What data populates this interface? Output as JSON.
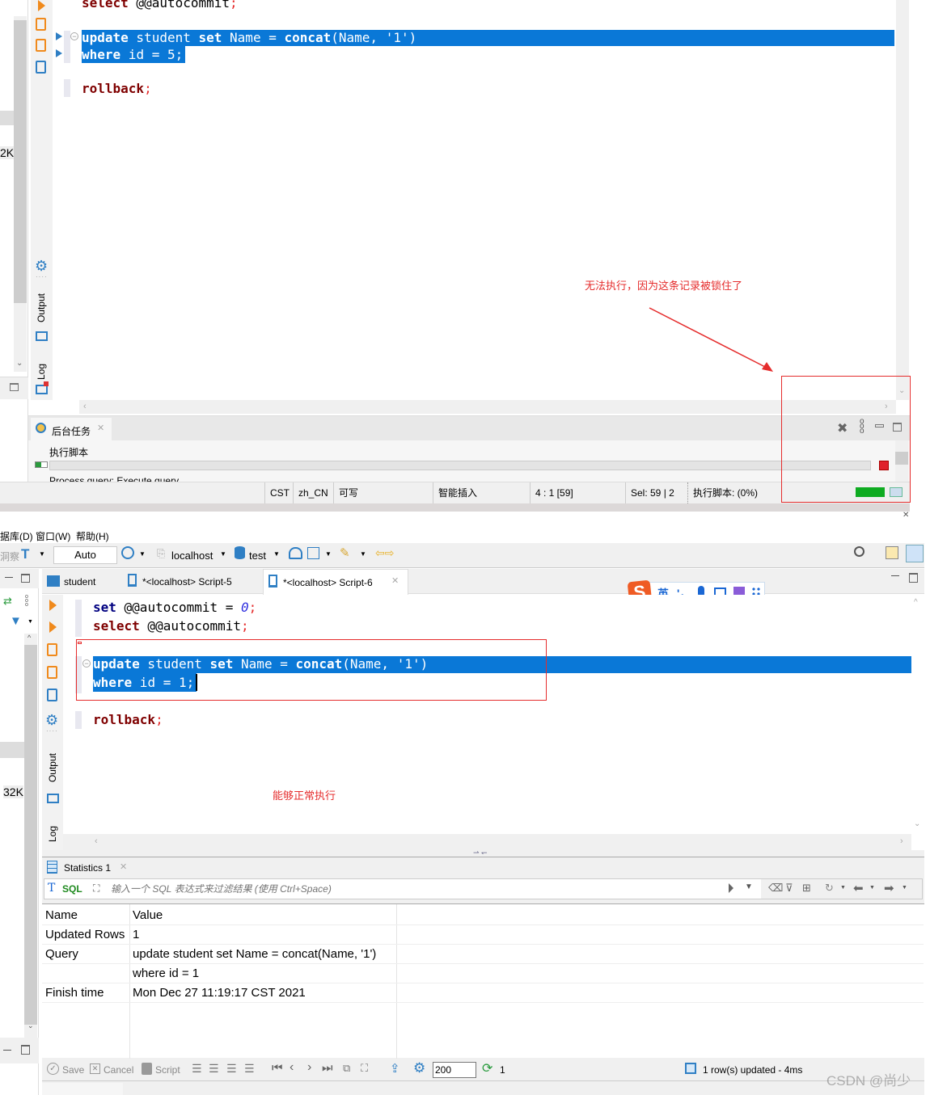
{
  "top_window": {
    "left_panel": {
      "size_label": "2K"
    },
    "code_lines": {
      "line1": {
        "kw": "select",
        "rest": " @@autocommit",
        "semi": ";"
      },
      "line_update": {
        "kw1": "update",
        "t1": " student ",
        "kw2": "set",
        "t2": " Name = ",
        "kw3": "concat",
        "t3": "(Name, '1')"
      },
      "line_where": {
        "kw": "where",
        "rest": " id = 5;"
      },
      "line_rollback": {
        "kw": "rollback",
        "semi": ";"
      }
    },
    "side_tabs": {
      "output": "Output",
      "log": "Log"
    },
    "annotation": "无法执行，因为这条记录被锁住了",
    "bg_tasks_panel": {
      "tab_label": "后台任务",
      "task_name": "执行脚本",
      "progress_percent": 0,
      "task_detail": "Process query:  Execute query"
    },
    "status_bar": {
      "timezone": "CST",
      "locale": "zh_CN",
      "write_mode": "可写",
      "insert_mode": "智能插入",
      "cursor_pos": "4 : 1 [59]",
      "selection": "Sel: 59 | 2",
      "task_status": "执行脚本:   (0%)"
    }
  },
  "bottom_window": {
    "menu": [
      "据库(D)",
      "窗口(W)",
      "帮助(H)"
    ],
    "toolbar": {
      "left_label": "洞察",
      "transaction_mode": "Auto",
      "connection": "localhost",
      "database": "test"
    },
    "left_panel": {
      "size_label": "32K"
    },
    "editor_tabs": [
      {
        "label": "student",
        "active": false
      },
      {
        "label": "*<localhost> Script-5",
        "active": false
      },
      {
        "label": "*<localhost> Script-6",
        "active": true
      }
    ],
    "ime_toolbar": {
      "lang": "英",
      "punct": "'，"
    },
    "code_lines": {
      "line_set": {
        "kw": "set",
        "rest": " @@autocommit = ",
        "num": "0",
        "semi": ";"
      },
      "line_select": {
        "kw": "select",
        "rest": " @@autocommit",
        "semi": ";"
      },
      "line_update": {
        "kw1": "update",
        "t1": " student ",
        "kw2": "set",
        "t2": " Name = ",
        "kw3": "concat",
        "t3": "(Name, '1')"
      },
      "line_where": {
        "kw": "where",
        "rest": " id = 1;"
      },
      "line_rollback": {
        "kw": "rollback",
        "semi": ";"
      }
    },
    "side_tabs": {
      "output": "Output",
      "log": "Log"
    },
    "annotation": "能够正常执行",
    "results": {
      "tab_label": "Statistics 1",
      "filter_mode": "SQL",
      "filter_placeholder": "输入一个 SQL 表达式来过滤结果 (使用 Ctrl+Space)",
      "columns": [
        "Name",
        "Value"
      ],
      "rows": [
        {
          "name": "Updated Rows",
          "value": "1"
        },
        {
          "name": "Query",
          "value": "update student set Name = concat(Name, '1')"
        },
        {
          "name": "",
          "value": "where id = 1"
        },
        {
          "name": "Finish time",
          "value": "Mon Dec 27 11:19:17 CST 2021"
        }
      ],
      "bottom_toolbar": {
        "save": "Save",
        "cancel": "Cancel",
        "script": "Script",
        "fetch_size": "200",
        "refresh_count": "1",
        "status": "1 row(s) updated - 4ms"
      }
    }
  },
  "watermark": "CSDN @尚少"
}
